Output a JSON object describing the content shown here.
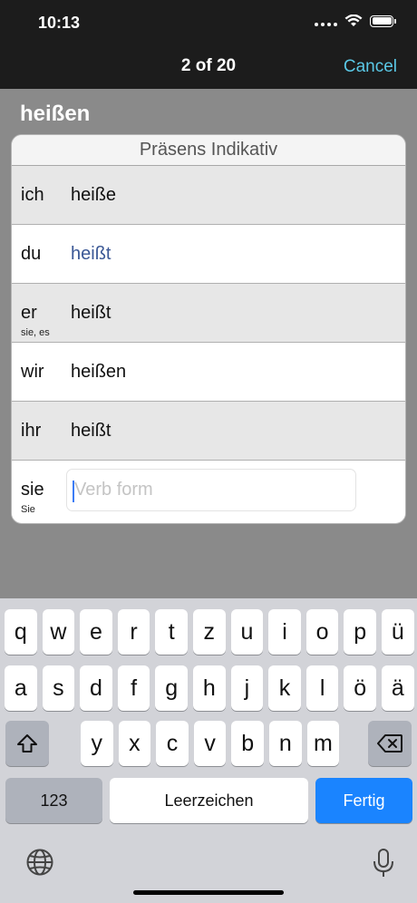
{
  "status": {
    "time": "10:13"
  },
  "nav": {
    "title": "2 of 20",
    "cancel": "Cancel"
  },
  "verb": "heißen",
  "card": {
    "header": "Präsens Indikativ",
    "rows": [
      {
        "pronoun": "ich",
        "sub": "",
        "form": "heiße"
      },
      {
        "pronoun": "du",
        "sub": "",
        "form": "heißt"
      },
      {
        "pronoun": "er",
        "sub": "sie, es",
        "form": "heißt"
      },
      {
        "pronoun": "wir",
        "sub": "",
        "form": "heißen"
      },
      {
        "pronoun": "ihr",
        "sub": "",
        "form": "heißt"
      },
      {
        "pronoun": "sie",
        "sub": "Sie",
        "form": ""
      }
    ],
    "input_placeholder": "Verb form"
  },
  "keyboard": {
    "row1": [
      "q",
      "w",
      "e",
      "r",
      "t",
      "z",
      "u",
      "i",
      "o",
      "p",
      "ü"
    ],
    "row2": [
      "a",
      "s",
      "d",
      "f",
      "g",
      "h",
      "j",
      "k",
      "l",
      "ö",
      "ä"
    ],
    "row3": [
      "y",
      "x",
      "c",
      "v",
      "b",
      "n",
      "m"
    ],
    "num_label": "123",
    "space_label": "Leerzeichen",
    "done_label": "Fertig",
    "shift_icon": "shift-icon",
    "delete_icon": "delete-icon",
    "globe_icon": "globe-icon",
    "mic_icon": "microphone-icon"
  },
  "colors": {
    "accent": "#1a84ff",
    "cancel": "#5ac8e6",
    "answer": "#3a5795"
  }
}
